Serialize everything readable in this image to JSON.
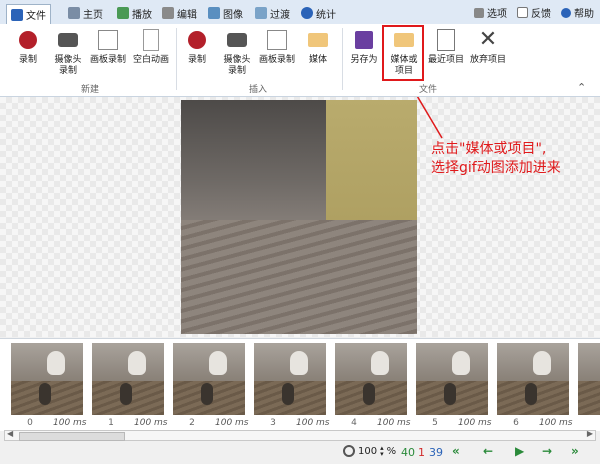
{
  "tabs": [
    {
      "label": "文件",
      "icon": "save-icon"
    },
    {
      "label": "主页",
      "icon": "home-icon"
    },
    {
      "label": "播放",
      "icon": "play-icon"
    },
    {
      "label": "编辑",
      "icon": "edit-icon"
    },
    {
      "label": "图像",
      "icon": "image-icon"
    },
    {
      "label": "过渡",
      "icon": "transition-icon"
    },
    {
      "label": "统计",
      "icon": "info-icon"
    }
  ],
  "right_links": {
    "options": "选项",
    "feedback": "反馈",
    "help": "帮助"
  },
  "ribbon": {
    "new_group": {
      "label": "新建",
      "buttons": [
        "录制",
        "摄像头\n录制",
        "画板录制",
        "空白动画"
      ]
    },
    "insert_group": {
      "label": "插入",
      "buttons": [
        "录制",
        "摄像头\n录制",
        "画板录制",
        "媒体"
      ]
    },
    "file_group": {
      "label": "文件",
      "buttons": [
        "另存为",
        "媒体或\n项目",
        "最近项目",
        "放弃项目"
      ]
    }
  },
  "annotation": {
    "line1": "点击\"媒体或项目\",",
    "line2": "选择gif动图添加进来"
  },
  "frames": [
    {
      "index": "0",
      "duration": "100 ms"
    },
    {
      "index": "1",
      "duration": "100 ms"
    },
    {
      "index": "2",
      "duration": "100 ms"
    },
    {
      "index": "3",
      "duration": "100 ms"
    },
    {
      "index": "4",
      "duration": "100 ms"
    },
    {
      "index": "5",
      "duration": "100 ms"
    },
    {
      "index": "6",
      "duration": "100 ms"
    }
  ],
  "status": {
    "zoom": "100",
    "percent": "%",
    "count_green": "40",
    "count_red": "1",
    "count_blue": "39"
  },
  "colors": {
    "accent": "#2b63b8",
    "annotation": "#e0191b",
    "nav_green": "#2a8a3a"
  }
}
